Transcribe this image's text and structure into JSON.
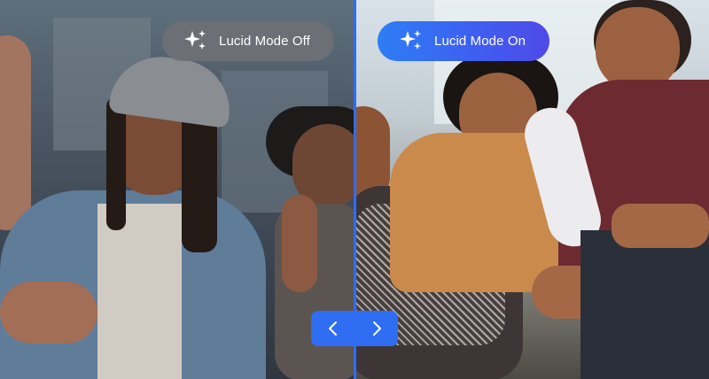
{
  "left_label": "Lucid Mode Off",
  "right_label": "Lucid Mode On",
  "slider": {
    "left_icon": "chevron-left-icon",
    "right_icon": "chevron-right-icon",
    "position": 0.5
  },
  "pill_icon": "sparkle-icon",
  "colors": {
    "accent": "#2f6df3",
    "pill_off": "#6e7076",
    "pill_on_start": "#2d7ef5",
    "pill_on_end": "#4f4ae8"
  }
}
